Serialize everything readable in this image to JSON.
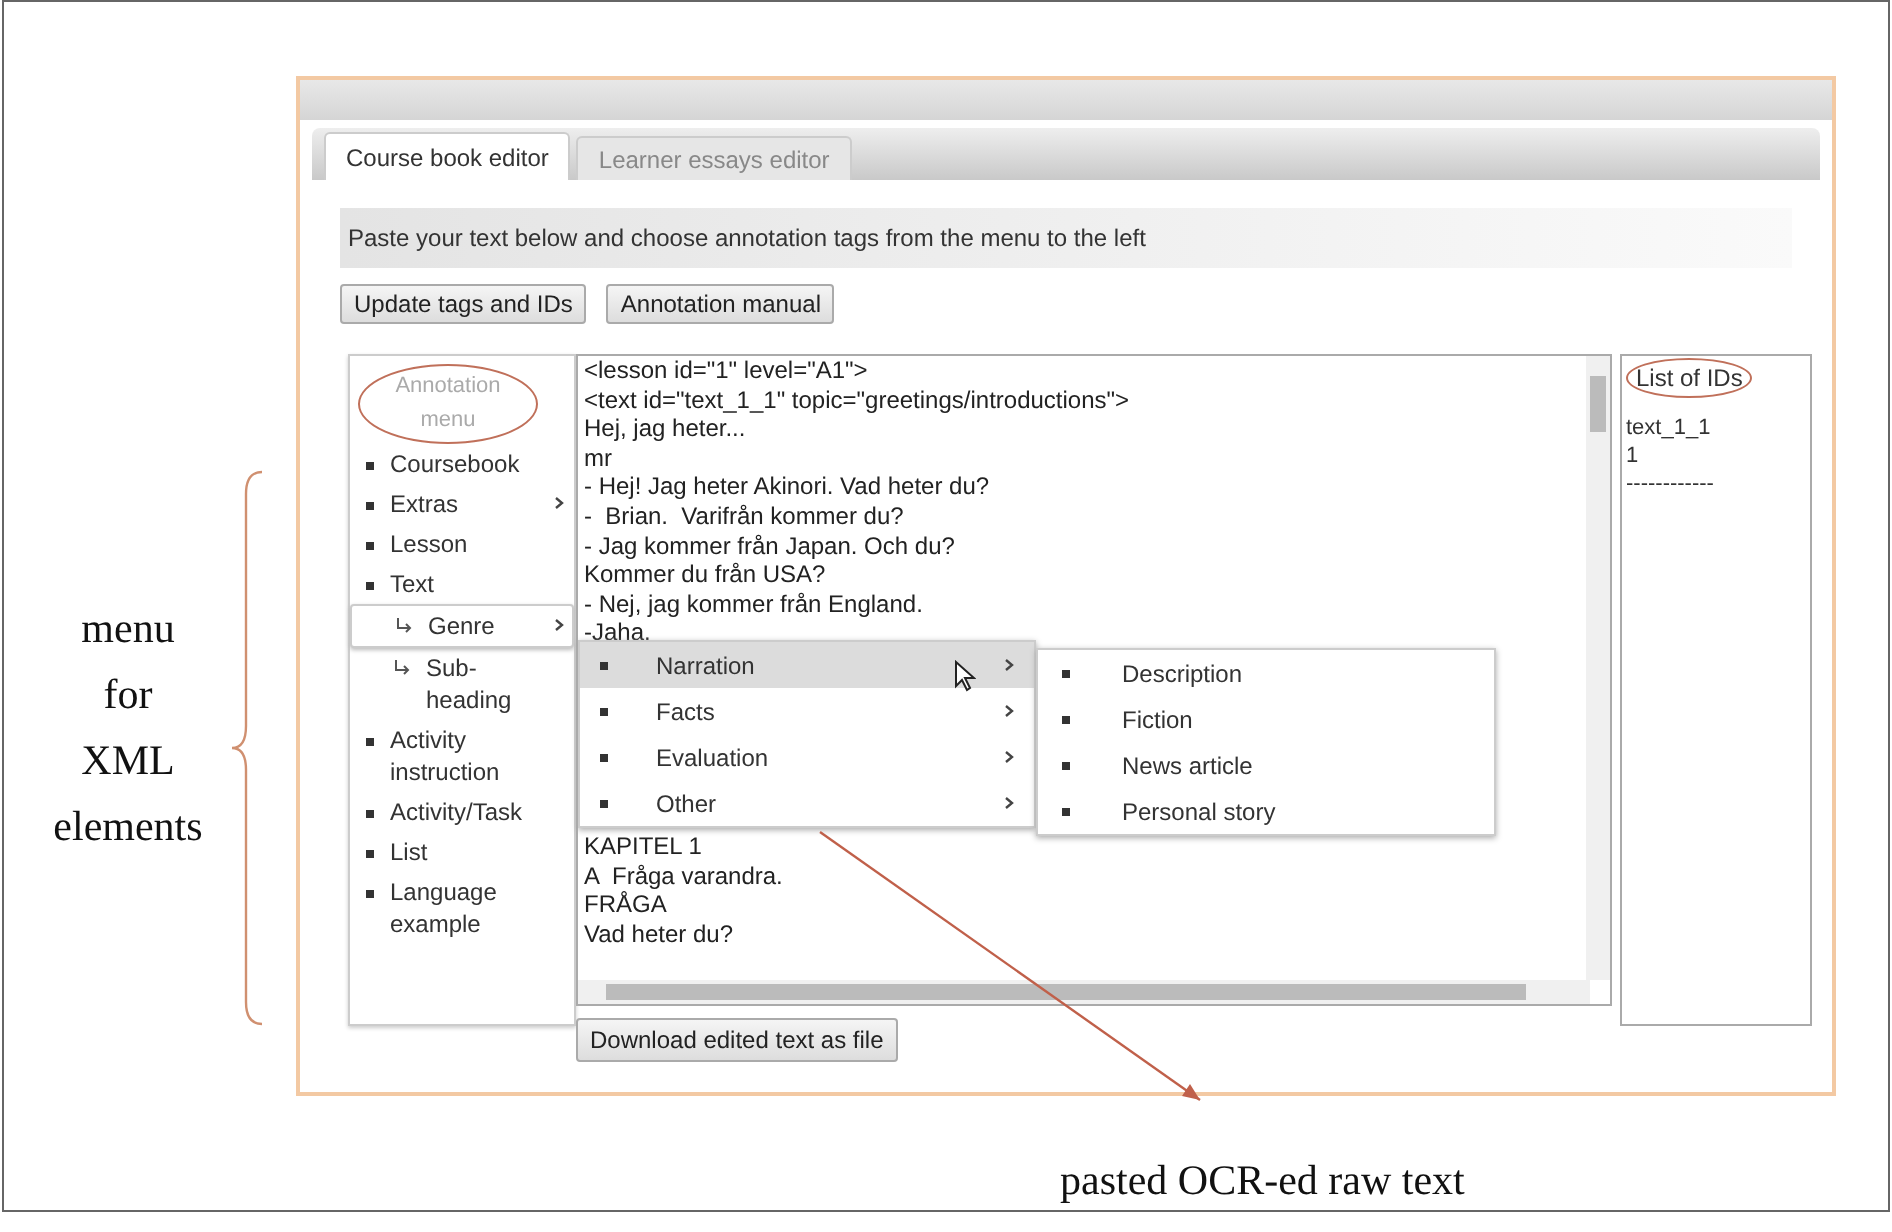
{
  "tabs": [
    {
      "label": "Course book editor",
      "selected": true
    },
    {
      "label": "Learner essays editor",
      "selected": false
    }
  ],
  "instruction": "Paste your text below and choose annotation tags from the menu to the left",
  "buttons": [
    "Update tags and IDs",
    "Annotation manual"
  ],
  "menu": {
    "title": "Annotation menu",
    "items": [
      {
        "label": "Coursebook",
        "kind": "bullet",
        "has_submenu": false,
        "selected": false
      },
      {
        "label": "Extras",
        "kind": "bullet",
        "has_submenu": true,
        "selected": false
      },
      {
        "label": "Lesson",
        "kind": "bullet",
        "has_submenu": false,
        "selected": false
      },
      {
        "label": "Text",
        "kind": "bullet",
        "has_submenu": false,
        "selected": false
      },
      {
        "label": "Genre",
        "kind": "child",
        "has_submenu": true,
        "selected": true
      },
      {
        "label": "Sub-heading",
        "kind": "child",
        "has_submenu": false,
        "selected": false
      },
      {
        "label": "Activity instruction",
        "kind": "bullet",
        "has_submenu": false,
        "selected": false
      },
      {
        "label": "Activity/Task",
        "kind": "bullet",
        "has_submenu": false,
        "selected": false
      },
      {
        "label": "List",
        "kind": "bullet",
        "has_submenu": false,
        "selected": false
      },
      {
        "label": "Language example",
        "kind": "bullet",
        "has_submenu": false,
        "selected": false
      }
    ]
  },
  "genre_menu": [
    {
      "label": "Narration",
      "selected": true
    },
    {
      "label": "Facts",
      "selected": false
    },
    {
      "label": "Evaluation",
      "selected": false
    },
    {
      "label": "Other",
      "selected": false
    }
  ],
  "narration_menu": [
    "Description",
    "Fiction",
    "News article",
    "Personal story"
  ],
  "editor": {
    "lines_top": [
      "<lesson id=\"1\" level=\"A1\">",
      "<text id=\"text_1_1\" topic=\"greetings/introductions\">",
      "Hej, jag heter...",
      "mr",
      "- Hej! Jag heter Akinori. Vad heter du?",
      "-  Brian.  Varifrån kommer du?",
      "- Jag kommer från Japan. Och du?",
      "Kommer du från USA?",
      "- Nej, jag kommer från England.",
      "-Jaha."
    ],
    "lines_bottom": [
      "KAPITEL 1",
      "A  Fråga varandra.",
      "FRÅGA",
      "Vad heter du?"
    ]
  },
  "ids_panel": {
    "title": "List of IDs",
    "lines": [
      "text_1_1",
      "1",
      "------------"
    ]
  },
  "download_button": "Download edited text as file",
  "annotations": {
    "side_label": [
      "menu",
      "for",
      "XML",
      "elements"
    ],
    "bottom_label": "pasted OCR-ed raw text"
  }
}
